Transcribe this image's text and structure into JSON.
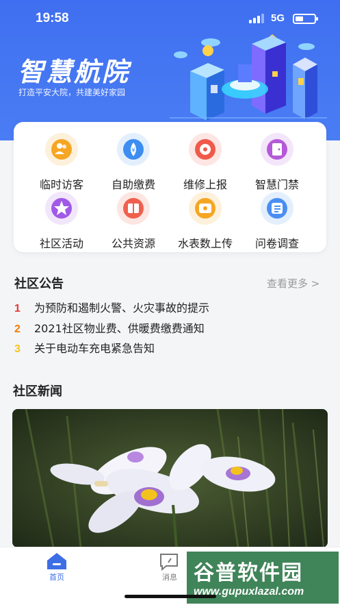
{
  "status_bar": {
    "time": "19:58",
    "network": "5G"
  },
  "header": {
    "title": "智慧航院",
    "slogan": "打造平安大院，共建美好家园"
  },
  "menu": [
    {
      "label": "临时访客",
      "icon": "visitor-icon",
      "color": "#f5a623",
      "bg": "#fdf1dc"
    },
    {
      "label": "自助缴费",
      "icon": "payment-icon",
      "color": "#3d8ef0",
      "bg": "#e3effd"
    },
    {
      "label": "维修上报",
      "icon": "repair-icon",
      "color": "#f05a4a",
      "bg": "#fde6e3"
    },
    {
      "label": "智慧门禁",
      "icon": "access-control-icon",
      "color": "#b45ad8",
      "bg": "#f4e6fa"
    },
    {
      "label": "社区活动",
      "icon": "activity-star-icon",
      "color": "#a05ae6",
      "bg": "#f1e6fb"
    },
    {
      "label": "公共资源",
      "icon": "resources-icon",
      "color": "#f0604e",
      "bg": "#fde6e2"
    },
    {
      "label": "水表数上传",
      "icon": "water-meter-icon",
      "color": "#f5a623",
      "bg": "#fdf1dc"
    },
    {
      "label": "问卷调查",
      "icon": "survey-list-icon",
      "color": "#4a8ef2",
      "bg": "#e3effd"
    }
  ],
  "announcements": {
    "title": "社区公告",
    "more": "查看更多 >",
    "items": [
      {
        "rank": "1",
        "text": "为预防和遏制火警、火灾事故的提示",
        "color": "#e53935"
      },
      {
        "rank": "2",
        "text": "2021社区物业费、供暖费缴费通知",
        "color": "#f57c00"
      },
      {
        "rank": "3",
        "text": "关于电动车充电紧急告知",
        "color": "#f9c41a"
      }
    ]
  },
  "news": {
    "title": "社区新闻"
  },
  "tabbar": [
    {
      "label": "首页",
      "icon": "home-icon",
      "active": true
    },
    {
      "label": "消息",
      "icon": "message-icon",
      "active": false
    }
  ],
  "watermark": {
    "line1": "谷普软件园",
    "line2": "www.gupuxlazal.com"
  },
  "colors": {
    "brand": "#4a7df4",
    "accent": "#3d6ee6",
    "inactive": "#999999"
  }
}
